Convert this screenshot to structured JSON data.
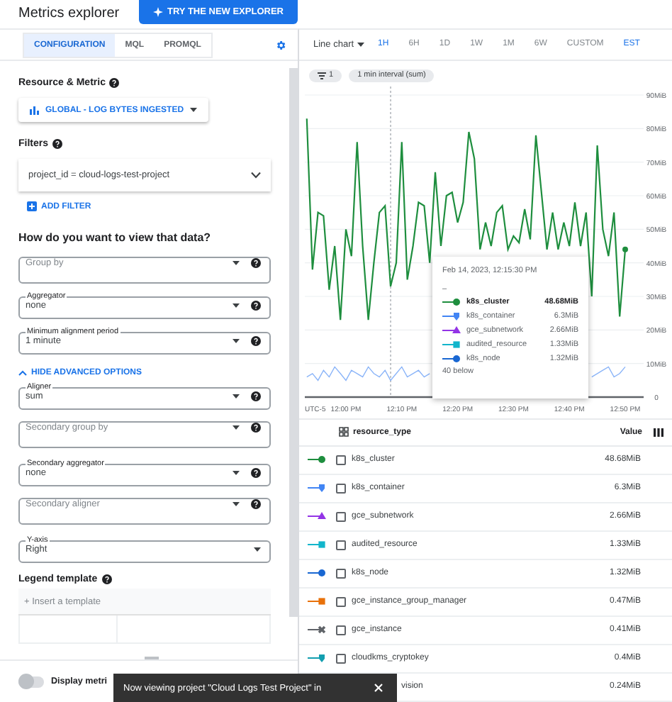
{
  "header": {
    "title": "Metrics explorer",
    "try_button": "TRY THE NEW EXPLORER"
  },
  "config_tabs": [
    {
      "label": "CONFIGURATION",
      "selected": true
    },
    {
      "label": "MQL",
      "selected": false
    },
    {
      "label": "PROMQL",
      "selected": false
    }
  ],
  "resource_metric": {
    "label": "Resource & Metric",
    "value": "GLOBAL - LOG BYTES INGESTED"
  },
  "filters": {
    "label": "Filters",
    "value": "project_id = cloud-logs-test-project",
    "add_button": "ADD FILTER"
  },
  "view_heading": "How do you want to view that data?",
  "basic_fields": [
    {
      "kind": "placeholder",
      "label": "Group by",
      "help": true
    },
    {
      "kind": "labeled",
      "label": "Aggregator",
      "value": "none",
      "help": true
    },
    {
      "kind": "labeled",
      "label": "Minimum alignment period",
      "value": "1 minute",
      "help": true
    }
  ],
  "advanced_toggle": {
    "label": "HIDE ADVANCED OPTIONS",
    "expanded": true
  },
  "advanced_fields": [
    {
      "kind": "labeled",
      "label": "Aligner",
      "value": "sum",
      "help": true
    },
    {
      "kind": "placeholder",
      "label": "Secondary group by",
      "help": true
    },
    {
      "kind": "labeled",
      "label": "Secondary aggregator",
      "value": "none",
      "help": true
    },
    {
      "kind": "placeholder",
      "label": "Secondary aligner",
      "help": true
    },
    {
      "kind": "labeled",
      "label": "Y-axis",
      "value": "Right",
      "help": false
    }
  ],
  "legend_template": {
    "label": "Legend template",
    "placeholder": "+ Insert a template"
  },
  "display_toggle": {
    "label": "Display metri",
    "on": false
  },
  "snackbar": {
    "text": "Now viewing project \"Cloud Logs Test Project\" in"
  },
  "chart_toolbar": {
    "chart_type": "Line chart",
    "ranges": [
      {
        "label": "1H",
        "selected": true
      },
      {
        "label": "6H",
        "selected": false
      },
      {
        "label": "1D",
        "selected": false
      },
      {
        "label": "1W",
        "selected": false
      },
      {
        "label": "1M",
        "selected": false
      },
      {
        "label": "6W",
        "selected": false
      },
      {
        "label": "CUSTOM",
        "selected": false
      }
    ],
    "timezone": "EST"
  },
  "chips": {
    "filter_count": "1",
    "interval": "1 min interval (sum)"
  },
  "chart": {
    "timezone_label": "UTC-5",
    "chart_data": {
      "type": "line",
      "categories": [
        null,
        null,
        null,
        null,
        null,
        null,
        null,
        "12:00 PM",
        null,
        null,
        null,
        null,
        null,
        null,
        null,
        null,
        null,
        "12:10 PM",
        null,
        null,
        null,
        null,
        null,
        null,
        null,
        null,
        null,
        "12:20 PM",
        null,
        null,
        null,
        null,
        null,
        null,
        null,
        null,
        null,
        "12:30 PM",
        null,
        null,
        null,
        null,
        null,
        null,
        null,
        null,
        null,
        "12:40 PM",
        null,
        null,
        null,
        null,
        null,
        null,
        null,
        null,
        null,
        "12:50 PM"
      ],
      "series": [
        {
          "color": "#1e8e3e",
          "values": [
            83,
            38,
            55,
            54,
            32,
            45,
            23,
            50,
            42,
            76,
            45,
            23,
            40,
            55,
            57,
            33,
            40,
            76,
            35,
            45,
            58,
            57,
            40,
            67,
            45,
            60,
            61,
            52,
            58,
            79,
            71,
            44,
            52,
            45,
            55,
            57,
            44,
            48,
            46,
            56,
            47,
            78,
            61,
            44,
            55,
            44,
            52,
            45,
            58,
            45,
            55,
            30,
            75,
            50,
            42,
            55,
            24,
            44
          ]
        },
        {
          "color": "#8ab4f8",
          "values": [
            6,
            7,
            5,
            8,
            6,
            9,
            7,
            5,
            8,
            7,
            6,
            9,
            7,
            6,
            8,
            5,
            7,
            9,
            6,
            7,
            8,
            6,
            7,
            null,
            null,
            null,
            null,
            null,
            null,
            null,
            null,
            null,
            null,
            null,
            null,
            null,
            null,
            null,
            null,
            null,
            null,
            null,
            null,
            null,
            null,
            null,
            null,
            null,
            null,
            null,
            null,
            6,
            7,
            8,
            9,
            6,
            7,
            9
          ]
        }
      ],
      "grid": true,
      "yticks": [
        {
          "value": 0,
          "label": "0"
        },
        {
          "value": 10,
          "label": "10MiB"
        },
        {
          "value": 20,
          "label": "20MiB"
        },
        {
          "value": 30,
          "label": "30MiB"
        },
        {
          "value": 40,
          "label": "40MiB"
        },
        {
          "value": 50,
          "label": "50MiB"
        },
        {
          "value": 60,
          "label": "60MiB"
        },
        {
          "value": 70,
          "label": "70MiB"
        },
        {
          "value": 80,
          "label": "80MiB"
        },
        {
          "value": 90,
          "label": "90MiB"
        }
      ],
      "ylim": [
        0,
        90
      ]
    }
  },
  "tooltip": {
    "time": "Feb 14, 2023, 12:15:30 PM",
    "separator": "–",
    "rows": [
      {
        "name": "k8s_cluster",
        "value": "48.68MiB",
        "color": "#1e8e3e",
        "kind": "circle"
      },
      {
        "name": "k8s_container",
        "value": "6.3MiB",
        "color": "#4285f4",
        "kind": "pin"
      },
      {
        "name": "gce_subnetwork",
        "value": "2.66MiB",
        "color": "#9334e6",
        "kind": "triangle"
      },
      {
        "name": "audited_resource",
        "value": "1.33MiB",
        "color": "#12b5cb",
        "kind": "square"
      },
      {
        "name": "k8s_node",
        "value": "1.32MiB",
        "color": "#1967d2",
        "kind": "circle"
      }
    ],
    "footer": "40 below"
  },
  "table": {
    "columns": [
      "resource_type",
      "Value"
    ],
    "rows": [
      {
        "name": "k8s_cluster",
        "value": "48.68MiB",
        "color": "#1e8e3e",
        "kind": "circle",
        "checked": false
      },
      {
        "name": "k8s_container",
        "value": "6.3MiB",
        "color": "#4285f4",
        "kind": "pin",
        "checked": false
      },
      {
        "name": "gce_subnetwork",
        "value": "2.66MiB",
        "color": "#9334e6",
        "kind": "triangle",
        "checked": false
      },
      {
        "name": "audited_resource",
        "value": "1.33MiB",
        "color": "#12b5cb",
        "kind": "square",
        "checked": false
      },
      {
        "name": "k8s_node",
        "value": "1.32MiB",
        "color": "#1967d2",
        "kind": "circle",
        "checked": false
      },
      {
        "name": "gce_instance_group_manager",
        "value": "0.47MiB",
        "color": "#e8710a",
        "kind": "square",
        "checked": false
      },
      {
        "name": "gce_instance",
        "value": "0.41MiB",
        "color": "#5f6368",
        "kind": "cross",
        "checked": false
      },
      {
        "name": "cloudkms_cryptokey",
        "value": "0.4MiB",
        "color": "#129eaf",
        "kind": "pin",
        "checked": false
      },
      {
        "name": "vision",
        "value": "0.24MiB",
        "kind": "covered"
      }
    ]
  }
}
